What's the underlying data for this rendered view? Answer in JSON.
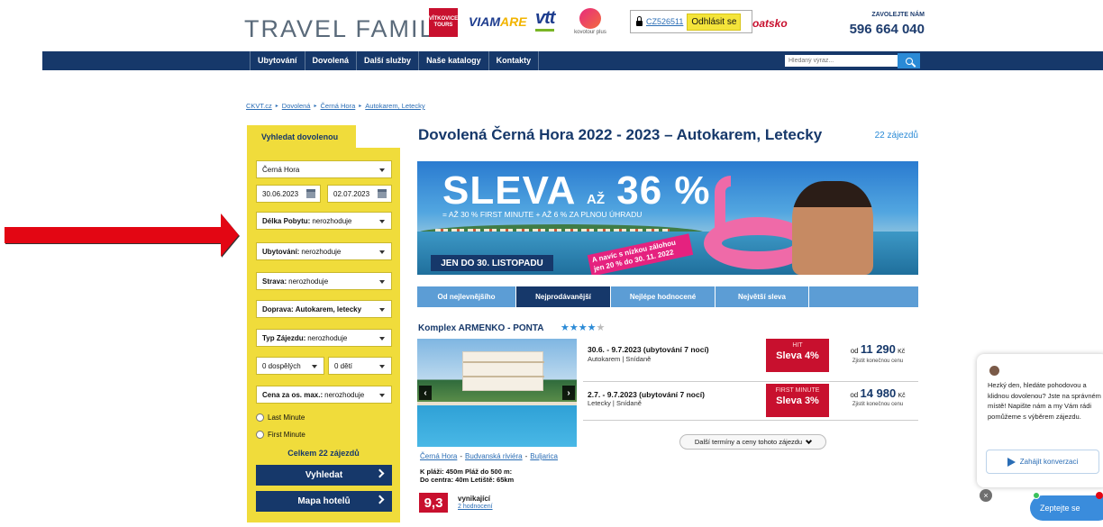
{
  "header": {
    "logo_main": "TRAVEL FAMIL",
    "brands": {
      "vitkovice": "VÍTKOVICE TOURS",
      "viamare_a": "VIAM",
      "viamare_b": "ARE",
      "vtt": "vtt",
      "kovotour": "kovotour plus"
    },
    "login_id": "CZ526511",
    "logout_label": "Odhlásit se",
    "region_text": "oatsko",
    "call_label": "ZAVOLEJTE NÁM",
    "phone": "596 664 040"
  },
  "nav": {
    "items": [
      "Ubytování",
      "Dovolená",
      "Další služby",
      "Naše katalogy",
      "Kontakty"
    ],
    "search_placeholder": "Hledaný výraz..."
  },
  "breadcrumb": [
    "CKVT.cz",
    "Dovolená",
    "Černá Hora",
    "Autokarem, Letecky"
  ],
  "sidebar": {
    "tab": "Vyhledat dovolenou",
    "destination": "Černá Hora",
    "date_from": "30.06.2023",
    "date_to": "02.07.2023",
    "length_label": "Délka Pobytu:",
    "length_value": "nerozhoduje",
    "accommodation_label": "Ubytování:",
    "accommodation_value": "nerozhoduje",
    "board_label": "Strava:",
    "board_value": "nerozhoduje",
    "transport_label": "Doprava:",
    "transport_value": "Autokarem, letecky",
    "trip_type_label": "Typ Zájezdu:",
    "trip_type_value": "nerozhoduje",
    "adults": "0 dospělých",
    "children": "0 dětí",
    "price_label": "Cena za os. max.:",
    "price_value": "nerozhoduje",
    "last_minute": "Last Minute",
    "first_minute": "First Minute",
    "total": "Celkem 22 zájezdů",
    "search_button": "Vyhledat",
    "map_button": "Mapa hotelů"
  },
  "main": {
    "title": "Dovolená Černá Hora 2022 - 2023 – Autokarem, Letecky",
    "trip_count": "22 zájezdů",
    "banner": {
      "sleva_a": "SLEVA",
      "sleva_az": "AŽ",
      "sleva_pct": "36 %",
      "subline": "= AŽ 30 % FIRST MINUTE + AŽ 6 % ZA PLNOU ÚHRADU",
      "deadline": "JEN DO 30. LISTOPADU",
      "promo": "A navíc s nízkou zálohou jen 20 % do 30. 11. 2022"
    },
    "tabs": [
      "Od nejlevnějšího",
      "Nejprodávanější",
      "Nejlépe hodnocené",
      "Největší sleva"
    ],
    "active_tab": 1
  },
  "hotel": {
    "name": "Komplex ARMENKO - PONTA",
    "stars": 4,
    "star_char": "★",
    "location": [
      "Černá Hora",
      "Budvanská riviéra",
      "Buljarica"
    ],
    "location_sep": "-",
    "facts_line1": "K pláži: 450m  Pláž do 500 m:",
    "facts_line2": "Do centra: 40m  Letiště: 65km",
    "rating": "9,3",
    "rating_word": "vynikající",
    "rating_count": "2 hodnocení",
    "offers": [
      {
        "dates": "30.6. - 9.7.2023 (ubytování 7 nocí)",
        "transport": "Autokarem | Snídaně",
        "badge": "HIT",
        "discount": "Sleva 4%",
        "from": "od",
        "price": "11 290",
        "currency": "Kč",
        "check": "Zjistit konečnou cenu"
      },
      {
        "dates": "2.7. - 9.7.2023 (ubytování 7 nocí)",
        "transport": "Letecky | Snídaně",
        "badge": "FIRST MINUTE",
        "discount": "Sleva 3%",
        "from": "od",
        "price": "14 980",
        "currency": "Kč",
        "check": "Zjistit konečnou cenu"
      }
    ],
    "more_terms": "Další termíny a ceny tohoto zájezdu"
  },
  "chat": {
    "message": "Hezký den, hledáte pohodovou a klidnou dovolenou? Jste na správném místě! Napište nám a my Vám rádi pomůžeme s výběrem zájezdu.",
    "start_button": "Zahájit konverzaci",
    "bubble": "Zeptejte se",
    "close": "×"
  },
  "colors": {
    "navy": "#16386a",
    "yellow": "#f0dc3b",
    "red": "#c8102e",
    "tab_blue": "#5c9dd5",
    "arrow_red": "#e30613"
  },
  "icons": [
    "lock-icon",
    "search-icon",
    "calendar-icon",
    "chevron-right-icon",
    "chevron-down-icon",
    "star-icon",
    "send-icon",
    "close-icon"
  ]
}
